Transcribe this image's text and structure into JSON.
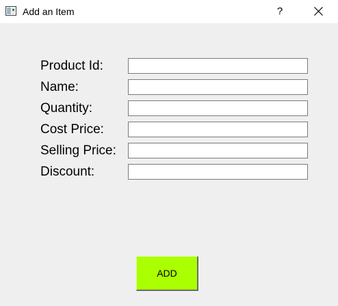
{
  "window": {
    "title": "Add an Item",
    "help_label": "?",
    "app_icon": "window-icon",
    "close_icon": "close-icon"
  },
  "form": {
    "fields": [
      {
        "label": "Product Id:",
        "value": ""
      },
      {
        "label": "Name:",
        "value": ""
      },
      {
        "label": "Quantity:",
        "value": ""
      },
      {
        "label": "Cost Price:",
        "value": ""
      },
      {
        "label": "Selling Price:",
        "value": ""
      },
      {
        "label": "Discount:",
        "value": ""
      }
    ],
    "submit_label": "ADD"
  },
  "colors": {
    "titlebar_bg": "#ffffff",
    "content_bg": "#efefef",
    "add_button_bg": "#aaff00"
  }
}
